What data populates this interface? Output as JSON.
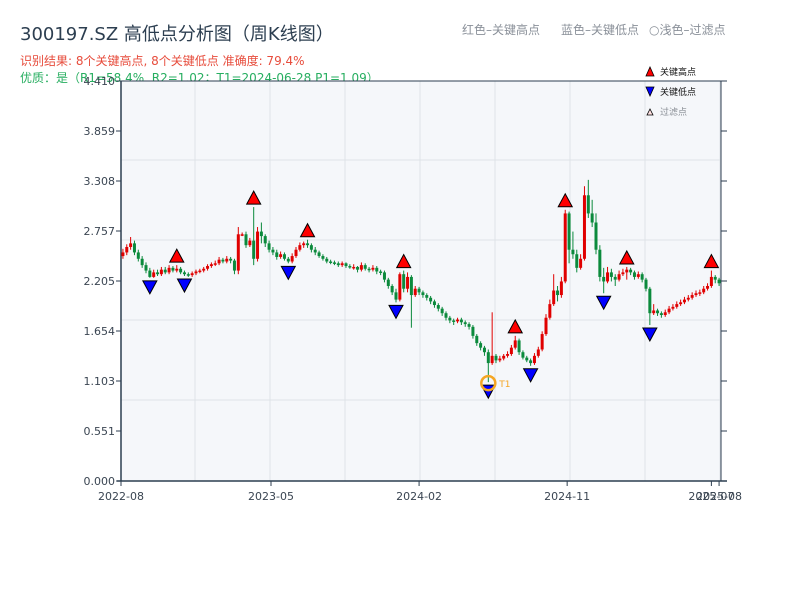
{
  "header": {
    "title": "300197.SZ 高低点分析图（周K线图）",
    "result_line": "识别结果: 8个关键高点, 8个关键低点   准确度: 79.4%",
    "quality_line": "优质：是（R1=58.4%, R2=1.02；T1=2024-06-28 P1=1.09）",
    "legend_red": "红色–关键高点",
    "legend_blue": "蓝色–关键低点",
    "legend_light": "○浅色–过滤点"
  },
  "colors": {
    "up": "#e00000",
    "down": "#0b8a3c",
    "high_marker": "#ff0000",
    "low_marker": "#0000ff",
    "t1_ring": "#f5a623",
    "plot_bg": "#f5f7fa",
    "axis": "#2c3e50"
  },
  "chart_data": {
    "type": "candlestick",
    "frequency": "weekly",
    "title": "300197.SZ 高低点分析图（周K线图）",
    "ylim": [
      0,
      4.41
    ],
    "y_ticks": [
      "0.000",
      "0.551",
      "1.103",
      "1.654",
      "2.205",
      "2.757",
      "3.308",
      "3.859",
      "4.410"
    ],
    "x_ticks": [
      {
        "index": 0,
        "label": "2022-08"
      },
      {
        "index": 39,
        "label": "2023-05"
      },
      {
        "index": 77.5,
        "label": "2024-02"
      },
      {
        "index": 116,
        "label": "2024-11"
      },
      {
        "index": 153.5,
        "label": "2025-07"
      },
      {
        "index": 155.5,
        "label": "2025-08"
      }
    ],
    "grid": true,
    "legend": {
      "position": "top-right",
      "items": [
        "关键高点",
        "关键低点",
        "过滤点"
      ]
    },
    "candles_ohlc": [
      [
        2.48,
        2.56,
        2.45,
        2.52
      ],
      [
        2.52,
        2.61,
        2.49,
        2.58
      ],
      [
        2.58,
        2.69,
        2.55,
        2.62
      ],
      [
        2.62,
        2.65,
        2.49,
        2.52
      ],
      [
        2.52,
        2.55,
        2.42,
        2.45
      ],
      [
        2.45,
        2.48,
        2.35,
        2.38
      ],
      [
        2.38,
        2.41,
        2.29,
        2.32
      ],
      [
        2.32,
        2.35,
        2.24,
        2.25
      ],
      [
        2.25,
        2.33,
        2.24,
        2.3
      ],
      [
        2.3,
        2.33,
        2.26,
        2.28
      ],
      [
        2.28,
        2.36,
        2.26,
        2.33
      ],
      [
        2.33,
        2.36,
        2.28,
        2.3
      ],
      [
        2.3,
        2.38,
        2.28,
        2.35
      ],
      [
        2.35,
        2.37,
        2.3,
        2.32
      ],
      [
        2.32,
        2.38,
        2.3,
        2.34
      ],
      [
        2.34,
        2.36,
        2.28,
        2.3
      ],
      [
        2.3,
        2.32,
        2.26,
        2.28
      ],
      [
        2.28,
        2.3,
        2.25,
        2.27
      ],
      [
        2.27,
        2.31,
        2.25,
        2.29
      ],
      [
        2.29,
        2.33,
        2.27,
        2.31
      ],
      [
        2.31,
        2.34,
        2.29,
        2.32
      ],
      [
        2.32,
        2.36,
        2.3,
        2.34
      ],
      [
        2.34,
        2.39,
        2.32,
        2.37
      ],
      [
        2.37,
        2.41,
        2.35,
        2.39
      ],
      [
        2.39,
        2.43,
        2.37,
        2.4
      ],
      [
        2.4,
        2.47,
        2.38,
        2.44
      ],
      [
        2.44,
        2.46,
        2.4,
        2.42
      ],
      [
        2.42,
        2.48,
        2.4,
        2.45
      ],
      [
        2.45,
        2.47,
        2.4,
        2.43
      ],
      [
        2.43,
        2.45,
        2.28,
        2.32
      ],
      [
        2.32,
        2.8,
        2.28,
        2.72
      ],
      [
        2.72,
        2.74,
        2.7,
        2.72
      ],
      [
        2.72,
        2.75,
        2.57,
        2.6
      ],
      [
        2.6,
        2.68,
        2.58,
        2.65
      ],
      [
        2.65,
        3.02,
        2.38,
        2.45
      ],
      [
        2.45,
        2.8,
        2.42,
        2.75
      ],
      [
        2.75,
        2.85,
        2.62,
        2.7
      ],
      [
        2.7,
        2.72,
        2.58,
        2.62
      ],
      [
        2.62,
        2.65,
        2.52,
        2.55
      ],
      [
        2.55,
        2.58,
        2.49,
        2.52
      ],
      [
        2.52,
        2.55,
        2.44,
        2.47
      ],
      [
        2.47,
        2.53,
        2.45,
        2.5
      ],
      [
        2.5,
        2.52,
        2.43,
        2.45
      ],
      [
        2.45,
        2.47,
        2.4,
        2.42
      ],
      [
        2.42,
        2.51,
        2.4,
        2.48
      ],
      [
        2.48,
        2.58,
        2.46,
        2.55
      ],
      [
        2.55,
        2.63,
        2.53,
        2.6
      ],
      [
        2.6,
        2.64,
        2.57,
        2.62
      ],
      [
        2.62,
        2.66,
        2.57,
        2.6
      ],
      [
        2.6,
        2.62,
        2.52,
        2.55
      ],
      [
        2.55,
        2.58,
        2.49,
        2.52
      ],
      [
        2.52,
        2.54,
        2.46,
        2.48
      ],
      [
        2.48,
        2.5,
        2.43,
        2.45
      ],
      [
        2.45,
        2.47,
        2.4,
        2.42
      ],
      [
        2.42,
        2.44,
        2.39,
        2.41
      ],
      [
        2.41,
        2.43,
        2.38,
        2.4
      ],
      [
        2.4,
        2.42,
        2.36,
        2.38
      ],
      [
        2.38,
        2.42,
        2.36,
        2.4
      ],
      [
        2.4,
        2.41,
        2.35,
        2.37
      ],
      [
        2.37,
        2.39,
        2.34,
        2.36
      ],
      [
        2.36,
        2.39,
        2.33,
        2.36
      ],
      [
        2.36,
        2.37,
        2.3,
        2.33
      ],
      [
        2.33,
        2.41,
        2.31,
        2.38
      ],
      [
        2.38,
        2.4,
        2.32,
        2.34
      ],
      [
        2.34,
        2.36,
        2.3,
        2.33
      ],
      [
        2.33,
        2.38,
        2.31,
        2.35
      ],
      [
        2.35,
        2.37,
        2.28,
        2.31
      ],
      [
        2.31,
        2.33,
        2.27,
        2.3
      ],
      [
        2.3,
        2.32,
        2.19,
        2.22
      ],
      [
        2.22,
        2.24,
        2.12,
        2.15
      ],
      [
        2.15,
        2.17,
        2.05,
        2.08
      ],
      [
        2.08,
        2.12,
        1.97,
        2.0
      ],
      [
        2.0,
        2.3,
        1.98,
        2.28
      ],
      [
        2.28,
        2.32,
        2.08,
        2.12
      ],
      [
        2.12,
        2.3,
        2.08,
        2.25
      ],
      [
        2.25,
        2.27,
        1.69,
        2.05
      ],
      [
        2.05,
        2.15,
        2.03,
        2.12
      ],
      [
        2.12,
        2.14,
        2.05,
        2.08
      ],
      [
        2.08,
        2.1,
        2.02,
        2.05
      ],
      [
        2.05,
        2.07,
        1.99,
        2.02
      ],
      [
        2.02,
        2.04,
        1.95,
        1.98
      ],
      [
        1.98,
        2.0,
        1.91,
        1.94
      ],
      [
        1.94,
        1.96,
        1.87,
        1.9
      ],
      [
        1.9,
        1.92,
        1.82,
        1.85
      ],
      [
        1.85,
        1.87,
        1.77,
        1.8
      ],
      [
        1.8,
        1.82,
        1.74,
        1.77
      ],
      [
        1.77,
        1.79,
        1.72,
        1.76
      ],
      [
        1.76,
        1.8,
        1.74,
        1.78
      ],
      [
        1.78,
        1.8,
        1.72,
        1.75
      ],
      [
        1.75,
        1.77,
        1.7,
        1.73
      ],
      [
        1.73,
        1.75,
        1.67,
        1.7
      ],
      [
        1.7,
        1.72,
        1.57,
        1.6
      ],
      [
        1.6,
        1.62,
        1.49,
        1.52
      ],
      [
        1.52,
        1.54,
        1.44,
        1.47
      ],
      [
        1.47,
        1.49,
        1.38,
        1.42
      ],
      [
        1.42,
        1.45,
        1.09,
        1.3
      ],
      [
        1.3,
        1.86,
        1.28,
        1.38
      ],
      [
        1.38,
        1.4,
        1.3,
        1.33
      ],
      [
        1.33,
        1.38,
        1.31,
        1.35
      ],
      [
        1.35,
        1.4,
        1.33,
        1.38
      ],
      [
        1.38,
        1.43,
        1.36,
        1.4
      ],
      [
        1.4,
        1.5,
        1.38,
        1.47
      ],
      [
        1.47,
        1.6,
        1.45,
        1.55
      ],
      [
        1.55,
        1.57,
        1.39,
        1.42
      ],
      [
        1.42,
        1.44,
        1.34,
        1.36
      ],
      [
        1.36,
        1.38,
        1.31,
        1.33
      ],
      [
        1.33,
        1.35,
        1.27,
        1.3
      ],
      [
        1.3,
        1.41,
        1.28,
        1.38
      ],
      [
        1.38,
        1.48,
        1.36,
        1.45
      ],
      [
        1.45,
        1.65,
        1.43,
        1.62
      ],
      [
        1.62,
        1.84,
        1.6,
        1.8
      ],
      [
        1.8,
        2.0,
        1.78,
        1.95
      ],
      [
        1.95,
        2.28,
        1.93,
        2.1
      ],
      [
        2.1,
        2.15,
        1.98,
        2.05
      ],
      [
        2.05,
        2.25,
        2.02,
        2.2
      ],
      [
        2.2,
        2.99,
        2.18,
        2.95
      ],
      [
        2.95,
        2.97,
        2.4,
        2.55
      ],
      [
        2.55,
        2.75,
        2.45,
        2.5
      ],
      [
        2.5,
        2.55,
        2.3,
        2.35
      ],
      [
        2.35,
        2.5,
        2.33,
        2.45
      ],
      [
        2.45,
        3.25,
        2.43,
        3.15
      ],
      [
        3.15,
        3.32,
        2.9,
        2.95
      ],
      [
        2.95,
        3.1,
        2.8,
        2.85
      ],
      [
        2.85,
        2.95,
        2.5,
        2.55
      ],
      [
        2.55,
        2.6,
        2.2,
        2.25
      ],
      [
        2.25,
        2.35,
        2.07,
        2.2
      ],
      [
        2.2,
        2.36,
        2.18,
        2.3
      ],
      [
        2.3,
        2.34,
        2.2,
        2.25
      ],
      [
        2.25,
        2.28,
        2.15,
        2.22
      ],
      [
        2.22,
        2.32,
        2.2,
        2.28
      ],
      [
        2.28,
        2.34,
        2.26,
        2.3
      ],
      [
        2.3,
        2.36,
        2.22,
        2.33
      ],
      [
        2.33,
        2.35,
        2.27,
        2.3
      ],
      [
        2.3,
        2.32,
        2.22,
        2.25
      ],
      [
        2.25,
        2.31,
        2.23,
        2.28
      ],
      [
        2.28,
        2.3,
        2.19,
        2.22
      ],
      [
        2.22,
        2.24,
        2.09,
        2.12
      ],
      [
        2.12,
        2.14,
        1.72,
        1.85
      ],
      [
        1.85,
        1.95,
        1.83,
        1.88
      ],
      [
        1.88,
        1.9,
        1.82,
        1.85
      ],
      [
        1.85,
        1.87,
        1.8,
        1.83
      ],
      [
        1.83,
        1.89,
        1.81,
        1.86
      ],
      [
        1.86,
        1.93,
        1.84,
        1.9
      ],
      [
        1.9,
        1.95,
        1.88,
        1.92
      ],
      [
        1.92,
        1.98,
        1.9,
        1.95
      ],
      [
        1.95,
        2.0,
        1.93,
        1.97
      ],
      [
        1.97,
        2.03,
        1.95,
        2.0
      ],
      [
        2.0,
        2.05,
        1.98,
        2.02
      ],
      [
        2.02,
        2.08,
        2.0,
        2.05
      ],
      [
        2.05,
        2.1,
        2.03,
        2.07
      ],
      [
        2.07,
        2.11,
        2.04,
        2.08
      ],
      [
        2.08,
        2.15,
        2.06,
        2.12
      ],
      [
        2.12,
        2.18,
        2.1,
        2.15
      ],
      [
        2.15,
        2.32,
        2.13,
        2.25
      ],
      [
        2.25,
        2.27,
        2.18,
        2.22
      ],
      [
        2.22,
        2.24,
        2.15,
        2.18
      ]
    ],
    "key_highs": [
      {
        "index": 14,
        "price": 2.38
      },
      {
        "index": 34,
        "price": 3.02
      },
      {
        "index": 48,
        "price": 2.66
      },
      {
        "index": 73,
        "price": 2.32
      },
      {
        "index": 102,
        "price": 1.6
      },
      {
        "index": 115,
        "price": 2.99
      },
      {
        "index": 131,
        "price": 2.36
      },
      {
        "index": 153,
        "price": 2.32
      }
    ],
    "key_lows": [
      {
        "index": 7,
        "price": 2.24
      },
      {
        "index": 16,
        "price": 2.26
      },
      {
        "index": 43,
        "price": 2.4
      },
      {
        "index": 71,
        "price": 1.97
      },
      {
        "index": 95,
        "price": 1.09
      },
      {
        "index": 106,
        "price": 1.27
      },
      {
        "index": 125,
        "price": 2.07
      },
      {
        "index": 137,
        "price": 1.72
      }
    ],
    "t1": {
      "index": 95,
      "price": 1.09,
      "label": "T1"
    }
  }
}
